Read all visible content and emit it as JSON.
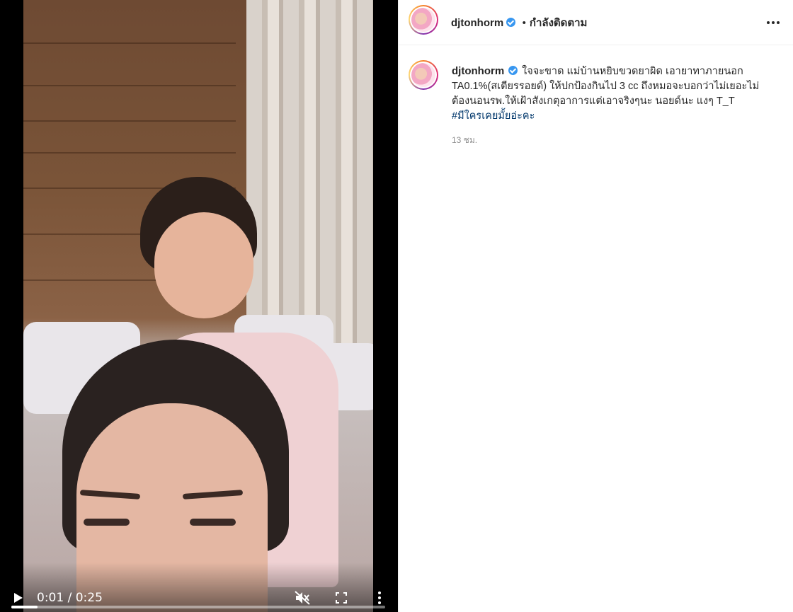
{
  "video": {
    "current_time": "0:01",
    "duration": "0:25",
    "time_display": "0:01 / 0:25",
    "progress": 0.07,
    "muted": true
  },
  "post": {
    "username": "djtonhorm",
    "verified": true,
    "separator": "•",
    "follow_status": "กำลังติดตาม",
    "caption_line1": "ใจจะขาด แม่บ้านหยิบขวดยาผิด เอายาทาภายนอก",
    "caption_line2": "TA0.1%(สเตียรรอยด์) ให้ปกป้องกินไป 3 cc ถึงหมอจะบอกว่าไม่เยอะไม่",
    "caption_line3": "ต้องนอนรพ.ให้เฝ้าสังเกตุอาการแต่เอาจริงๆนะ นอยด์นะ แงๆ T_T",
    "hashtag": "#มีใครเคยมั้ยอ่ะคะ",
    "time_ago": "13 ชม."
  },
  "icons": {
    "play": "play-icon",
    "mute": "muted-speaker-icon",
    "fullscreen": "fullscreen-icon",
    "more_video": "vertical-dots-icon",
    "more_post": "horizontal-dots-icon",
    "verified": "verified-badge-icon"
  },
  "colors": {
    "verified": "#3897f0",
    "hashtag": "#00376b",
    "timestamp": "#8e8e8e"
  }
}
